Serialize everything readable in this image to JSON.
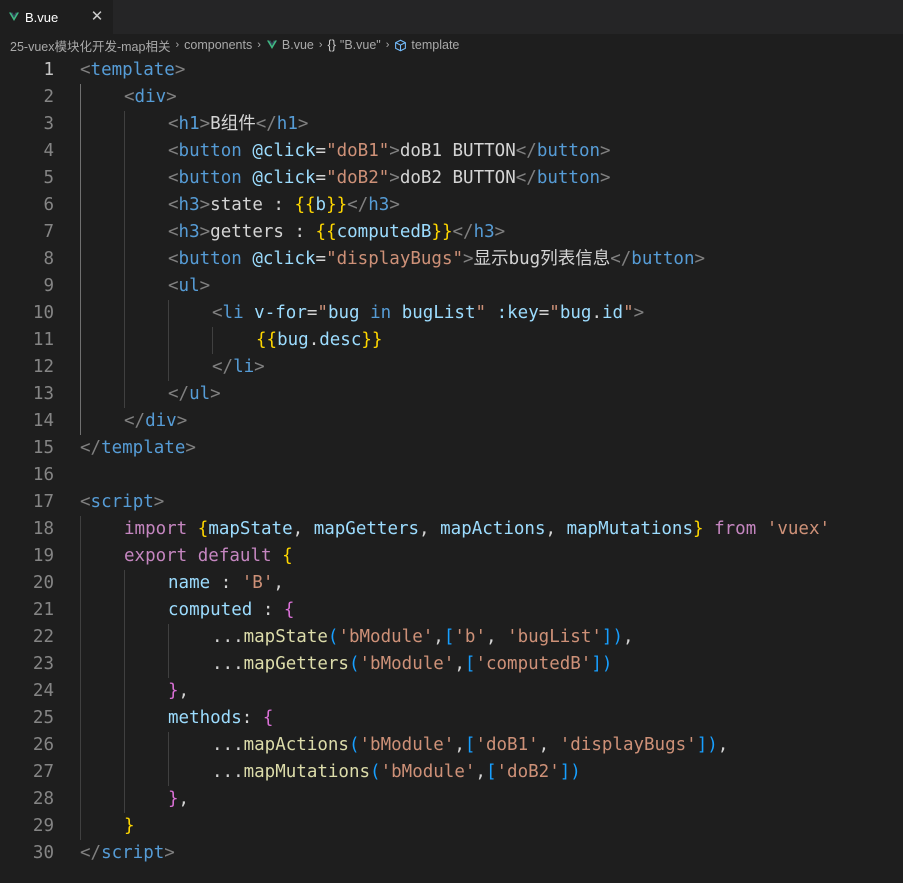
{
  "tab": {
    "label": "B.vue",
    "close_glyph": "✕",
    "icon": "vue-icon",
    "vue_color": "#41b883"
  },
  "breadcrumb": {
    "items": [
      "25-vuex模块化开发-map相关",
      "components",
      "B.vue",
      "\"B.vue\"",
      "template"
    ],
    "brace_glyph": "{}",
    "separator": "›"
  },
  "editor": {
    "active_line": 1,
    "lines": [
      {
        "n": "1",
        "indent": 0,
        "tokens": [
          [
            "p",
            "<"
          ],
          [
            "t",
            "template"
          ],
          [
            "p",
            ">"
          ]
        ]
      },
      {
        "n": "2",
        "indent": 1,
        "tokens": [
          [
            "p",
            "<"
          ],
          [
            "t",
            "div"
          ],
          [
            "p",
            ">"
          ]
        ]
      },
      {
        "n": "3",
        "indent": 2,
        "tokens": [
          [
            "p",
            "<"
          ],
          [
            "t",
            "h1"
          ],
          [
            "p",
            ">"
          ],
          [
            "x",
            "B组件"
          ],
          [
            "p",
            "</"
          ],
          [
            "t",
            "h1"
          ],
          [
            "p",
            ">"
          ]
        ]
      },
      {
        "n": "4",
        "indent": 2,
        "tokens": [
          [
            "p",
            "<"
          ],
          [
            "t",
            "button"
          ],
          [
            "x",
            " "
          ],
          [
            "a",
            "@click"
          ],
          [
            "x",
            "="
          ],
          [
            "s",
            "\"doB1\""
          ],
          [
            "p",
            ">"
          ],
          [
            "x",
            "doB1 BUTTON"
          ],
          [
            "p",
            "</"
          ],
          [
            "t",
            "button"
          ],
          [
            "p",
            ">"
          ]
        ]
      },
      {
        "n": "5",
        "indent": 2,
        "tokens": [
          [
            "p",
            "<"
          ],
          [
            "t",
            "button"
          ],
          [
            "x",
            " "
          ],
          [
            "a",
            "@click"
          ],
          [
            "x",
            "="
          ],
          [
            "s",
            "\"doB2\""
          ],
          [
            "p",
            ">"
          ],
          [
            "x",
            "doB2 BUTTON"
          ],
          [
            "p",
            "</"
          ],
          [
            "t",
            "button"
          ],
          [
            "p",
            ">"
          ]
        ]
      },
      {
        "n": "6",
        "indent": 2,
        "tokens": [
          [
            "p",
            "<"
          ],
          [
            "t",
            "h3"
          ],
          [
            "p",
            ">"
          ],
          [
            "x",
            "state : "
          ],
          [
            "b",
            "{{"
          ],
          [
            "v",
            "b"
          ],
          [
            "b",
            "}}"
          ],
          [
            "p",
            "</"
          ],
          [
            "t",
            "h3"
          ],
          [
            "p",
            ">"
          ]
        ]
      },
      {
        "n": "7",
        "indent": 2,
        "tokens": [
          [
            "p",
            "<"
          ],
          [
            "t",
            "h3"
          ],
          [
            "p",
            ">"
          ],
          [
            "x",
            "getters : "
          ],
          [
            "b",
            "{{"
          ],
          [
            "v",
            "computedB"
          ],
          [
            "b",
            "}}"
          ],
          [
            "p",
            "</"
          ],
          [
            "t",
            "h3"
          ],
          [
            "p",
            ">"
          ]
        ]
      },
      {
        "n": "8",
        "indent": 2,
        "tokens": [
          [
            "p",
            "<"
          ],
          [
            "t",
            "button"
          ],
          [
            "x",
            " "
          ],
          [
            "a",
            "@click"
          ],
          [
            "x",
            "="
          ],
          [
            "s",
            "\"displayBugs\""
          ],
          [
            "p",
            ">"
          ],
          [
            "x",
            "显示bug列表信息"
          ],
          [
            "p",
            "</"
          ],
          [
            "t",
            "button"
          ],
          [
            "p",
            ">"
          ]
        ]
      },
      {
        "n": "9",
        "indent": 2,
        "tokens": [
          [
            "p",
            "<"
          ],
          [
            "t",
            "ul"
          ],
          [
            "p",
            ">"
          ]
        ]
      },
      {
        "n": "10",
        "indent": 3,
        "tokens": [
          [
            "p",
            "<"
          ],
          [
            "t",
            "li"
          ],
          [
            "x",
            " "
          ],
          [
            "a",
            "v-for"
          ],
          [
            "x",
            "="
          ],
          [
            "s",
            "\""
          ],
          [
            "v",
            "bug"
          ],
          [
            "x",
            " "
          ],
          [
            "t",
            "in"
          ],
          [
            "x",
            " "
          ],
          [
            "v",
            "bugList"
          ],
          [
            "s",
            "\""
          ],
          [
            "x",
            " "
          ],
          [
            "a",
            ":key"
          ],
          [
            "x",
            "="
          ],
          [
            "s",
            "\""
          ],
          [
            "v",
            "bug"
          ],
          [
            "x",
            "."
          ],
          [
            "v",
            "id"
          ],
          [
            "s",
            "\""
          ],
          [
            "p",
            ">"
          ]
        ]
      },
      {
        "n": "11",
        "indent": 4,
        "tokens": [
          [
            "b",
            "{{"
          ],
          [
            "v",
            "bug"
          ],
          [
            "x",
            "."
          ],
          [
            "v",
            "desc"
          ],
          [
            "b",
            "}}"
          ]
        ]
      },
      {
        "n": "12",
        "indent": 3,
        "tokens": [
          [
            "p",
            "</"
          ],
          [
            "t",
            "li"
          ],
          [
            "p",
            ">"
          ]
        ]
      },
      {
        "n": "13",
        "indent": 2,
        "tokens": [
          [
            "p",
            "</"
          ],
          [
            "t",
            "ul"
          ],
          [
            "p",
            ">"
          ]
        ]
      },
      {
        "n": "14",
        "indent": 1,
        "tokens": [
          [
            "p",
            "</"
          ],
          [
            "t",
            "div"
          ],
          [
            "p",
            ">"
          ]
        ]
      },
      {
        "n": "15",
        "indent": 0,
        "tokens": [
          [
            "p",
            "</"
          ],
          [
            "t",
            "template"
          ],
          [
            "p",
            ">"
          ]
        ]
      },
      {
        "n": "16",
        "indent": 0,
        "tokens": []
      },
      {
        "n": "17",
        "indent": 0,
        "tokens": [
          [
            "p",
            "<"
          ],
          [
            "t",
            "script"
          ],
          [
            "p",
            ">"
          ]
        ]
      },
      {
        "n": "18",
        "indent": 1,
        "tokens": [
          [
            "k",
            "import"
          ],
          [
            "x",
            " "
          ],
          [
            "b",
            "{"
          ],
          [
            "v",
            "mapState"
          ],
          [
            "x",
            ", "
          ],
          [
            "v",
            "mapGetters"
          ],
          [
            "x",
            ", "
          ],
          [
            "v",
            "mapActions"
          ],
          [
            "x",
            ", "
          ],
          [
            "v",
            "mapMutations"
          ],
          [
            "b",
            "}"
          ],
          [
            "x",
            " "
          ],
          [
            "k",
            "from"
          ],
          [
            "x",
            " "
          ],
          [
            "s",
            "'vuex'"
          ]
        ]
      },
      {
        "n": "19",
        "indent": 1,
        "tokens": [
          [
            "k",
            "export"
          ],
          [
            "x",
            " "
          ],
          [
            "k",
            "default"
          ],
          [
            "x",
            " "
          ],
          [
            "b",
            "{"
          ]
        ]
      },
      {
        "n": "20",
        "indent": 2,
        "tokens": [
          [
            "v",
            "name"
          ],
          [
            "x",
            " : "
          ],
          [
            "s",
            "'B'"
          ],
          [
            "x",
            ","
          ]
        ]
      },
      {
        "n": "21",
        "indent": 2,
        "tokens": [
          [
            "v",
            "computed"
          ],
          [
            "x",
            " : "
          ],
          [
            "b2",
            "{"
          ]
        ]
      },
      {
        "n": "22",
        "indent": 3,
        "tokens": [
          [
            "x",
            "..."
          ],
          [
            "f",
            "mapState"
          ],
          [
            "b3",
            "("
          ],
          [
            "s",
            "'bModule'"
          ],
          [
            "x",
            ","
          ],
          [
            "b3",
            "["
          ],
          [
            "s",
            "'b'"
          ],
          [
            "x",
            ", "
          ],
          [
            "s",
            "'bugList'"
          ],
          [
            "b3",
            "]"
          ],
          [
            "b3",
            ")"
          ],
          [
            "x",
            ","
          ]
        ]
      },
      {
        "n": "23",
        "indent": 3,
        "tokens": [
          [
            "x",
            "..."
          ],
          [
            "f",
            "mapGetters"
          ],
          [
            "b3",
            "("
          ],
          [
            "s",
            "'bModule'"
          ],
          [
            "x",
            ","
          ],
          [
            "b3",
            "["
          ],
          [
            "s",
            "'computedB'"
          ],
          [
            "b3",
            "]"
          ],
          [
            "b3",
            ")"
          ]
        ]
      },
      {
        "n": "24",
        "indent": 2,
        "tokens": [
          [
            "b2",
            "}"
          ],
          [
            "x",
            ","
          ]
        ]
      },
      {
        "n": "25",
        "indent": 2,
        "tokens": [
          [
            "v",
            "methods"
          ],
          [
            "x",
            ": "
          ],
          [
            "b2",
            "{"
          ]
        ]
      },
      {
        "n": "26",
        "indent": 3,
        "tokens": [
          [
            "x",
            "..."
          ],
          [
            "f",
            "mapActions"
          ],
          [
            "b3",
            "("
          ],
          [
            "s",
            "'bModule'"
          ],
          [
            "x",
            ","
          ],
          [
            "b3",
            "["
          ],
          [
            "s",
            "'doB1'"
          ],
          [
            "x",
            ", "
          ],
          [
            "s",
            "'displayBugs'"
          ],
          [
            "b3",
            "]"
          ],
          [
            "b3",
            ")"
          ],
          [
            "x",
            ","
          ]
        ]
      },
      {
        "n": "27",
        "indent": 3,
        "tokens": [
          [
            "x",
            "..."
          ],
          [
            "f",
            "mapMutations"
          ],
          [
            "b3",
            "("
          ],
          [
            "s",
            "'bModule'"
          ],
          [
            "x",
            ","
          ],
          [
            "b3",
            "["
          ],
          [
            "s",
            "'doB2'"
          ],
          [
            "b3",
            "]"
          ],
          [
            "b3",
            ")"
          ]
        ]
      },
      {
        "n": "28",
        "indent": 2,
        "tokens": [
          [
            "b2",
            "}"
          ],
          [
            "x",
            ","
          ]
        ]
      },
      {
        "n": "29",
        "indent": 1,
        "tokens": [
          [
            "b",
            "}"
          ]
        ]
      },
      {
        "n": "30",
        "indent": 0,
        "tokens": [
          [
            "p",
            "</"
          ],
          [
            "t",
            "script"
          ],
          [
            "p",
            ">"
          ]
        ]
      }
    ]
  }
}
